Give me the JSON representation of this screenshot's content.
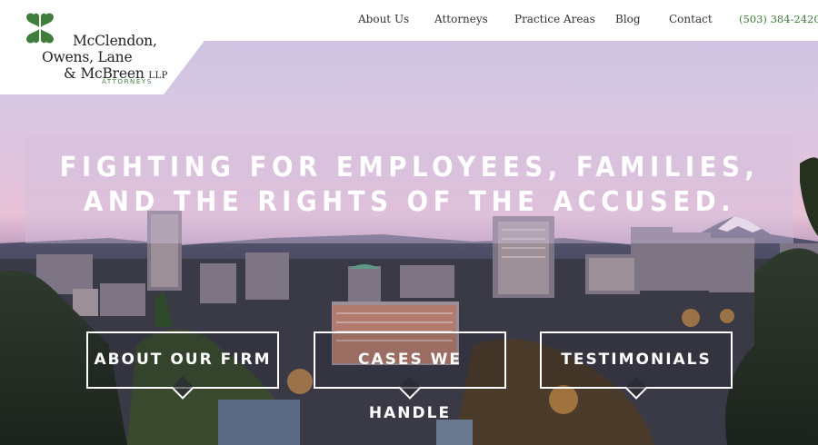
{
  "logo": {
    "name_line1": "McClendon,",
    "name_line2": "Owens, Lane",
    "name_line3": "& McBreen",
    "name_suffix": "LLP",
    "tagline": "ATTORNEYS",
    "icon": "four-leaf-clover-icon",
    "accent_color": "#3f7d3a"
  },
  "nav": {
    "items": [
      {
        "label": "About Us"
      },
      {
        "label": "Attorneys"
      },
      {
        "label": "Practice Areas"
      },
      {
        "label": "Blog"
      },
      {
        "label": "Contact"
      }
    ],
    "phone": "(503) 384-2420"
  },
  "hero": {
    "headline_line1": "FIGHTING FOR EMPLOYEES, FAMILIES,",
    "headline_line2": "AND THE RIGHTS OF THE ACCUSED."
  },
  "cta": [
    {
      "label": "ABOUT OUR FIRM"
    },
    {
      "label": "CASES WE HANDLE"
    },
    {
      "label": "TESTIMONIALS"
    }
  ]
}
